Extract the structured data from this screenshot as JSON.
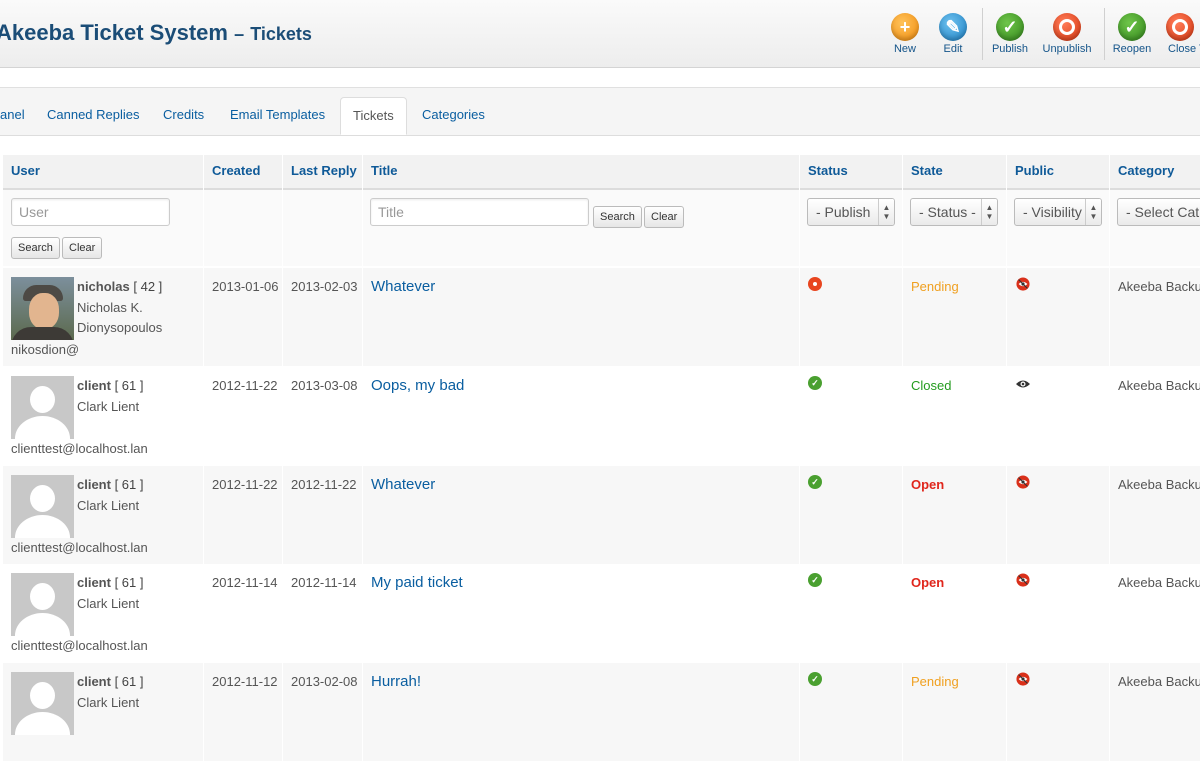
{
  "header": {
    "title": "Akeeba Ticket System",
    "dash": "–",
    "subtitle": "Tickets"
  },
  "toolbar": {
    "new": "New",
    "edit": "Edit",
    "publish": "Publish",
    "unpublish": "Unpublish",
    "reopen": "Reopen",
    "close": "Close T"
  },
  "tabs": {
    "control_panel": "anel",
    "canned_replies": "Canned Replies",
    "credits": "Credits",
    "email_templates": "Email Templates",
    "tickets": "Tickets",
    "categories": "Categories"
  },
  "columns": {
    "user": "User",
    "created": "Created",
    "last_reply": "Last Reply",
    "title": "Title",
    "status": "Status",
    "state": "State",
    "public": "Public",
    "category": "Category"
  },
  "filters": {
    "user_placeholder": "User",
    "title_placeholder": "Title",
    "search": "Search",
    "clear": "Clear",
    "status": "- Publish",
    "state": "- Status -",
    "visibility": "- Visibility",
    "category": "- Select Cat"
  },
  "rows": [
    {
      "username": "nicholas",
      "userid": " [ 42 ]",
      "fullname": "Nicholas K. Dionysopoulos",
      "email": "nikosdion@",
      "created": "2013-01-06",
      "last_reply": "2013-02-03",
      "title": "Whatever",
      "status": "unpublished",
      "state": "Pending",
      "public": "private",
      "category": "Akeeba Backu"
    },
    {
      "username": "client",
      "userid": " [ 61 ]",
      "fullname": "Clark Lient",
      "email": "clienttest@localhost.lan",
      "created": "2012-11-22",
      "last_reply": "2013-03-08",
      "title": "Oops, my bad",
      "status": "published",
      "state": "Closed",
      "public": "public",
      "category": "Akeeba Backu"
    },
    {
      "username": "client",
      "userid": " [ 61 ]",
      "fullname": "Clark Lient",
      "email": "clienttest@localhost.lan",
      "created": "2012-11-22",
      "last_reply": "2012-11-22",
      "title": "Whatever",
      "status": "published",
      "state": "Open",
      "public": "private",
      "category": "Akeeba Backu"
    },
    {
      "username": "client",
      "userid": " [ 61 ]",
      "fullname": "Clark Lient",
      "email": "clienttest@localhost.lan",
      "created": "2012-11-14",
      "last_reply": "2012-11-14",
      "title": "My paid ticket",
      "status": "published",
      "state": "Open",
      "public": "private",
      "category": "Akeeba Backu"
    },
    {
      "username": "client",
      "userid": " [ 61 ]",
      "fullname": "Clark Lient",
      "email": "",
      "created": "2012-11-12",
      "last_reply": "2013-02-08",
      "title": "Hurrah!",
      "status": "published",
      "state": "Pending",
      "public": "private",
      "category": "Akeeba Backu"
    }
  ]
}
